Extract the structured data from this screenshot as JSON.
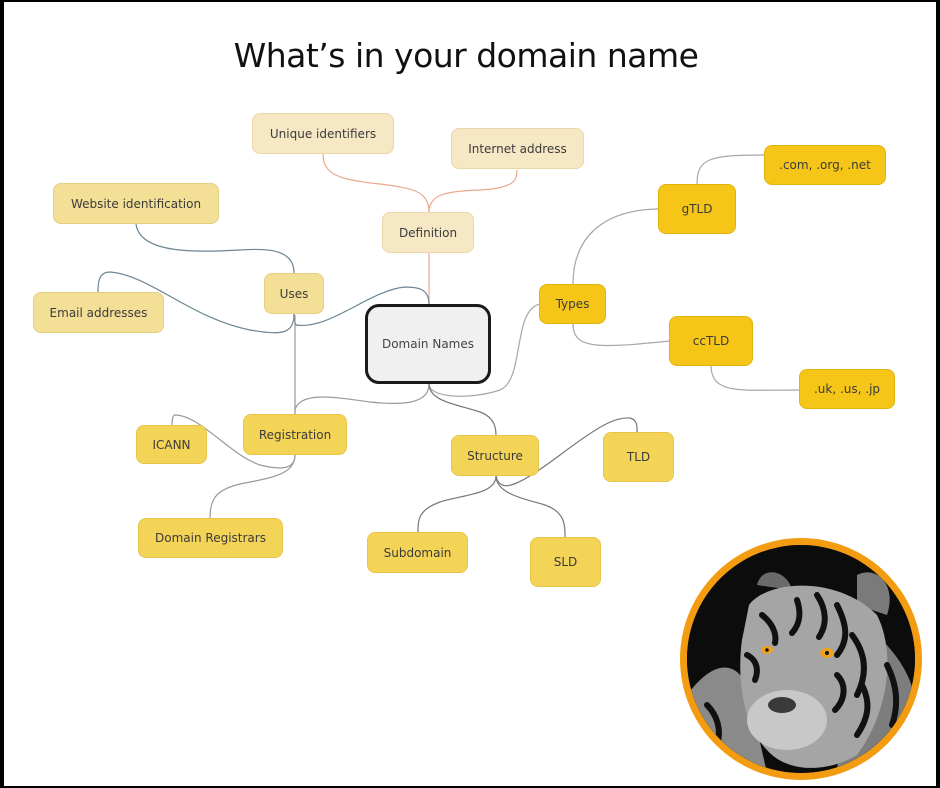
{
  "title": "What’s in your domain name",
  "center": {
    "label": "Domain Names"
  },
  "branches": {
    "definition": {
      "label": "Definition",
      "children": [
        "Unique identifiers",
        "Internet address"
      ]
    },
    "uses": {
      "label": "Uses",
      "children": [
        "Website identification",
        "Email addresses"
      ]
    },
    "types": {
      "label": "Types",
      "children": [
        {
          "label": "gTLD",
          "example": ".com, .org, .net"
        },
        {
          "label": "ccTLD",
          "example": ".uk, .us, .jp"
        }
      ]
    },
    "registration": {
      "label": "Registration",
      "children": [
        "ICANN",
        "Domain Registrars"
      ]
    },
    "structure": {
      "label": "Structure",
      "children": [
        "TLD",
        "Subdomain",
        "SLD"
      ]
    }
  },
  "colors": {
    "cream": "#f6e8c4",
    "pale_yellow": "#f3df95",
    "mid_yellow": "#f4d457",
    "gold": "#f5c518",
    "avatar_ring": "#f39c12",
    "center_border": "#1a1a1a"
  },
  "image": {
    "subject": "black-and-white tiger portrait with amber eyes"
  }
}
